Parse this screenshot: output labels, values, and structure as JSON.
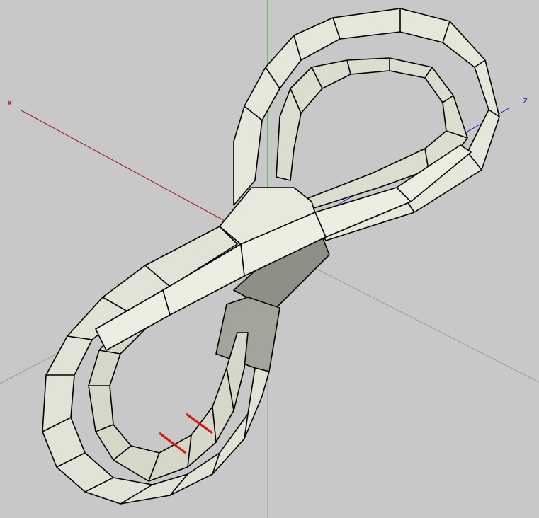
{
  "viewport": {
    "background": "#c8c8c8",
    "axes": {
      "x": {
        "label": "x",
        "color": "#a01010"
      },
      "y": {
        "label": "",
        "color": "#10a010"
      },
      "z": {
        "label": "z",
        "color": "#1020c0"
      }
    },
    "model": {
      "description_name": "figure-eight-tube",
      "face_light": "#ecece0",
      "face_mid": "#d9d9cc",
      "face_dark": "#9a9a90",
      "edge": "#000000",
      "highlight_edge": "#e01010"
    }
  }
}
